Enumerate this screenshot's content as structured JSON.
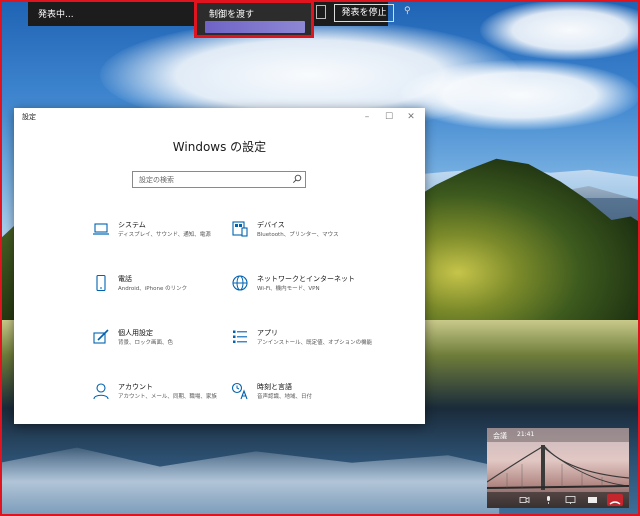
{
  "presenter_bar": {
    "status": "発表中...",
    "give_control": "制御を渡す",
    "stop_presenting": "発表を停止"
  },
  "settings": {
    "window_title": "設定",
    "heading": "Windows の設定",
    "search_placeholder": "設定の検索",
    "tiles": [
      {
        "title": "システム",
        "desc": "ディスプレイ、サウンド、通知、電源",
        "icon": "laptop-icon"
      },
      {
        "title": "デバイス",
        "desc": "Bluetooth、プリンター、マウス",
        "icon": "devices-icon"
      },
      {
        "title": "電話",
        "desc": "Android、iPhone のリンク",
        "icon": "phone-icon"
      },
      {
        "title": "ネットワークとインターネット",
        "desc": "Wi-Fi、機内モード、VPN",
        "icon": "globe-icon"
      },
      {
        "title": "個人用設定",
        "desc": "背景、ロック画面、色",
        "icon": "personalization-icon"
      },
      {
        "title": "アプリ",
        "desc": "アンインストール、既定値、オプションの機能",
        "icon": "apps-icon"
      },
      {
        "title": "アカウント",
        "desc": "アカウント、メール、同期、職場、家族",
        "icon": "account-icon"
      },
      {
        "title": "時刻と言語",
        "desc": "音声認識、地域、日付",
        "icon": "time-language-icon"
      }
    ]
  },
  "meeting": {
    "title": "会議",
    "time": "21:41"
  },
  "colors": {
    "accent": "#0063b1",
    "frame_red": "#e0141e",
    "hangup": "#c4262e"
  }
}
